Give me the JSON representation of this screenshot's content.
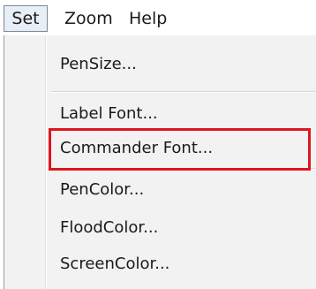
{
  "menubar": {
    "items": [
      {
        "label": "Set",
        "active": true
      },
      {
        "label": "Zoom",
        "active": false
      },
      {
        "label": "Help",
        "active": false
      }
    ]
  },
  "dropdown": {
    "items": [
      {
        "label": "PenSize..."
      },
      {
        "label": "Label Font..."
      },
      {
        "label": "Commander Font..."
      },
      {
        "label": "PenColor...",
        "highlighted": true
      },
      {
        "label": "FloodColor..."
      },
      {
        "label": "ScreenColor..."
      }
    ]
  },
  "colors": {
    "highlight": "#e0141e",
    "menu_background": "#f2f2f2",
    "active_menu_background": "#e8eef5"
  }
}
